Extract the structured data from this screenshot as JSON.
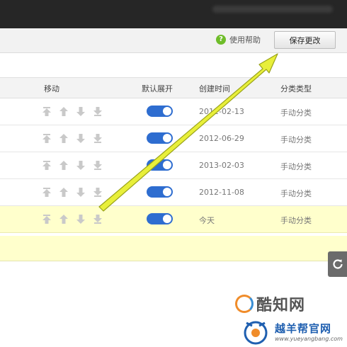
{
  "toolbar": {
    "help_label": "使用帮助",
    "help_icon_glyph": "?",
    "save_label": "保存更改"
  },
  "table": {
    "headers": {
      "move": "移动",
      "default_expand": "默认展开",
      "created": "创建时间",
      "type": "分类类型"
    },
    "rows": [
      {
        "created": "2012-02-13",
        "type": "手动分类",
        "expanded": true,
        "highlight": false
      },
      {
        "created": "2012-06-29",
        "type": "手动分类",
        "expanded": true,
        "highlight": false
      },
      {
        "created": "2013-02-03",
        "type": "手动分类",
        "expanded": true,
        "highlight": false
      },
      {
        "created": "2012-11-08",
        "type": "手动分类",
        "expanded": true,
        "highlight": false
      },
      {
        "created": "今天",
        "type": "手动分类",
        "expanded": true,
        "highlight": true
      }
    ],
    "move_icons": [
      "move-to-top-icon",
      "move-up-icon",
      "move-down-icon",
      "move-to-bottom-icon"
    ]
  },
  "annotation": {
    "arrow_color": "#e8ef3a",
    "arrow_outline": "#9aa31a"
  },
  "colors": {
    "toggle_on": "#2e6dd0",
    "highlight_row": "#ffffcc",
    "topbar": "#262626"
  },
  "watermarks": {
    "site1": "酷知网",
    "site2_title": "越羊帮官网",
    "site2_url": "www.yueyangbang.com"
  }
}
